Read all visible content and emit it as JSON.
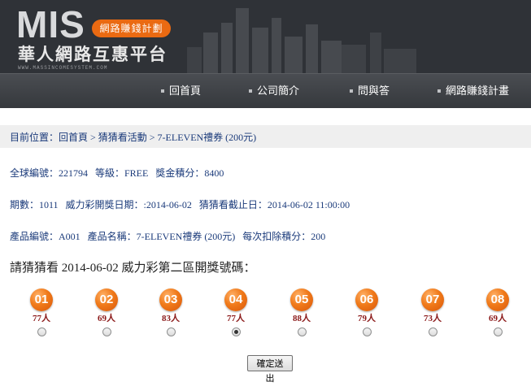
{
  "header": {
    "logo_text": "MIS",
    "logo_badge": "網路賺錢計劃",
    "logo_subtitle": "華人網路互惠平台",
    "logo_url": "WWW.MASSINCOMESYSTEM.COM"
  },
  "nav": [
    {
      "label": "回首頁",
      "icon": "square-bullet-icon"
    },
    {
      "label": "公司簡介",
      "icon": "square-bullet-icon"
    },
    {
      "label": "問與答",
      "icon": "square-bullet-icon"
    },
    {
      "label": "網路賺錢計畫",
      "icon": "square-bullet-icon"
    }
  ],
  "breadcrumb": "目前位置：回首頁 > 猜猜看活動 > 7-ELEVEN禮券 (200元)",
  "info": {
    "line1": "全球編號：221794   等級：FREE   獎金積分：8400",
    "line2": "期數：1011   威力彩開獎日期：:2014-06-02   猜猜看截止日：2014-06-02 11:00:00",
    "line3": "產品編號：A001   產品名稱：7-ELEVEN禮券 (200元)   每次扣除積分：200"
  },
  "question": "請猜猜看 2014-06-02 威力彩第二區開獎號碼：",
  "balls": [
    {
      "number": "01",
      "count": "77人",
      "selected": false
    },
    {
      "number": "02",
      "count": "69人",
      "selected": false
    },
    {
      "number": "03",
      "count": "83人",
      "selected": false
    },
    {
      "number": "04",
      "count": "77人",
      "selected": true
    },
    {
      "number": "05",
      "count": "88人",
      "selected": false
    },
    {
      "number": "06",
      "count": "79人",
      "selected": false
    },
    {
      "number": "07",
      "count": "73人",
      "selected": false
    },
    {
      "number": "08",
      "count": "69人",
      "selected": false
    }
  ],
  "submit_label": "確定送出",
  "colors": {
    "header_bg": "#2f3237",
    "nav_bg": "#3b3e43",
    "accent_orange": "#ea6a12",
    "link_blue": "#1a3a7a",
    "count_red": "#8b1a1a"
  }
}
